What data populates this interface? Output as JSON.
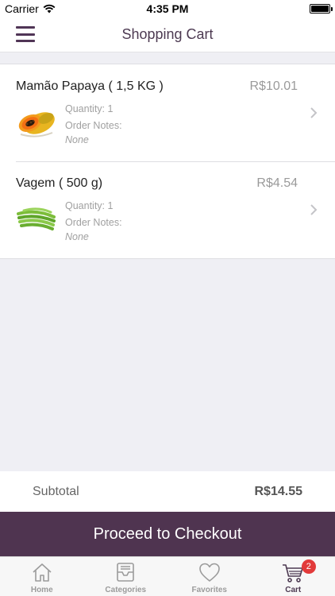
{
  "status_bar": {
    "carrier": "Carrier",
    "time": "4:35 PM",
    "battery_level": 1.0
  },
  "nav": {
    "title": "Shopping Cart",
    "menu_icon": "hamburger-menu-icon"
  },
  "cart_items": [
    {
      "name": "Mamão Papaya ( 1,5 KG )",
      "price": "R$10.01",
      "quantity_text": "Quantity: 1",
      "notes_label": "Order Notes:",
      "notes_value": "None",
      "image": "papaya-image"
    },
    {
      "name": "Vagem ( 500 g)",
      "price": "R$4.54",
      "quantity_text": "Quantity: 1",
      "notes_label": "Order Notes:",
      "notes_value": "None",
      "image": "green-beans-image"
    }
  ],
  "subtotal": {
    "label": "Subtotal",
    "value": "R$14.55"
  },
  "checkout": {
    "label": "Proceed to Checkout"
  },
  "tabs": [
    {
      "label": "Home",
      "icon": "home-icon",
      "active": false
    },
    {
      "label": "Categories",
      "icon": "inbox-icon",
      "active": false
    },
    {
      "label": "Favorites",
      "icon": "heart-icon",
      "active": false
    },
    {
      "label": "Cart",
      "icon": "cart-icon",
      "active": true,
      "badge": "2"
    }
  ],
  "colors": {
    "accent": "#4f3450",
    "badge": "#e23a3a",
    "background": "#efeff4"
  }
}
